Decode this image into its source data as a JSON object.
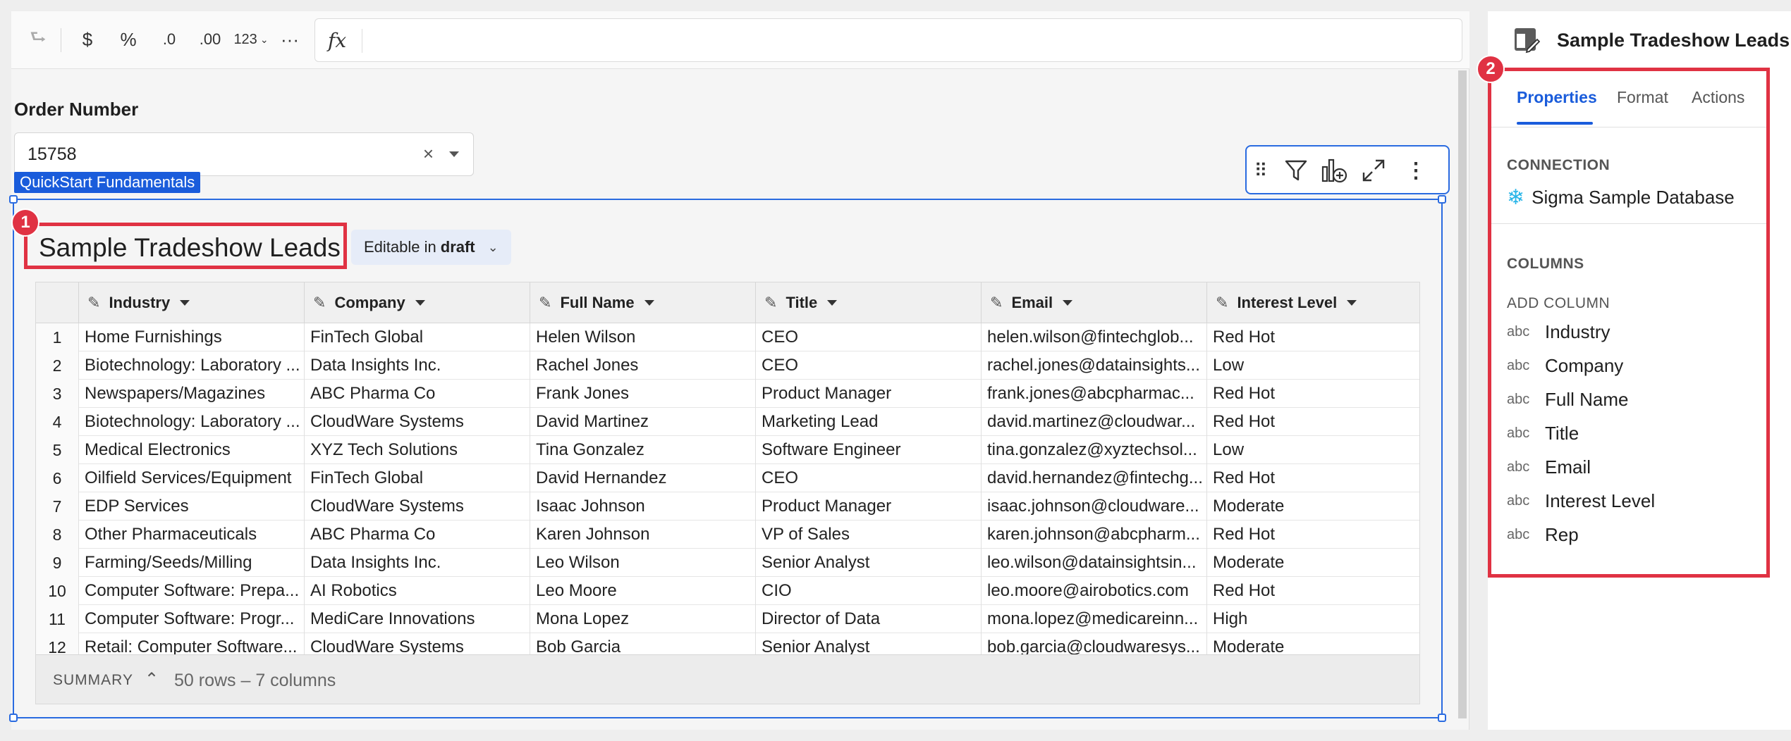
{
  "toolbar": {
    "redo_icon": "redo-icon",
    "currency_label": "$",
    "percent_label": "%",
    "decrease_decimals_label": ".0",
    "increase_decimals_label": ".00",
    "number_format_label": "123",
    "more_label": "···",
    "fx_label": "fx"
  },
  "control": {
    "label": "Order Number",
    "value": "15758",
    "clear_label": "×"
  },
  "tag": "QuickStart Fundamentals",
  "element": {
    "title": "Sample Tradeshow Leads",
    "badge": "1",
    "edit_prefix": "Editable in",
    "edit_state": "draft"
  },
  "table": {
    "columns": [
      "Industry",
      "Company",
      "Full Name",
      "Title",
      "Email",
      "Interest Level"
    ],
    "rows": [
      [
        "1",
        "Home Furnishings",
        "FinTech Global",
        "Helen Wilson",
        "CEO",
        "helen.wilson@fintechglob...",
        "Red Hot"
      ],
      [
        "2",
        "Biotechnology: Laboratory ...",
        "Data Insights Inc.",
        "Rachel Jones",
        "CEO",
        "rachel.jones@datainsights...",
        "Low"
      ],
      [
        "3",
        "Newspapers/Magazines",
        "ABC Pharma Co",
        "Frank Jones",
        "Product Manager",
        "frank.jones@abcpharmac...",
        "Red Hot"
      ],
      [
        "4",
        "Biotechnology: Laboratory ...",
        "CloudWare Systems",
        "David Martinez",
        "Marketing Lead",
        "david.martinez@cloudwar...",
        "Red Hot"
      ],
      [
        "5",
        "Medical Electronics",
        "XYZ Tech Solutions",
        "Tina Gonzalez",
        "Software Engineer",
        "tina.gonzalez@xyztechsol...",
        "Low"
      ],
      [
        "6",
        "Oilfield Services/Equipment",
        "FinTech Global",
        "David Hernandez",
        "CEO",
        "david.hernandez@fintechg...",
        "Red Hot"
      ],
      [
        "7",
        "EDP Services",
        "CloudWare Systems",
        "Isaac Johnson",
        "Product Manager",
        "isaac.johnson@cloudware...",
        "Moderate"
      ],
      [
        "8",
        "Other Pharmaceuticals",
        "ABC Pharma Co",
        "Karen Johnson",
        "VP of Sales",
        "karen.johnson@abcpharm...",
        "Red Hot"
      ],
      [
        "9",
        "Farming/Seeds/Milling",
        "Data Insights Inc.",
        "Leo Wilson",
        "Senior Analyst",
        "leo.wilson@datainsightsin...",
        "Moderate"
      ],
      [
        "10",
        "Computer Software: Prepa...",
        "AI Robotics",
        "Leo Moore",
        "CIO",
        "leo.moore@airobotics.com",
        "Red Hot"
      ],
      [
        "11",
        "Computer Software: Progr...",
        "MediCare Innovations",
        "Mona Lopez",
        "Director of Data",
        "mona.lopez@medicareinn...",
        "High"
      ],
      [
        "12",
        "Retail: Computer Software...",
        "CloudWare Systems",
        "Bob Garcia",
        "Senior Analyst",
        "bob.garcia@cloudwaresys...",
        "Moderate"
      ]
    ],
    "summary_label": "SUMMARY",
    "summary_count": "50 rows – 7 columns"
  },
  "panel": {
    "title": "Sample Tradeshow Leads",
    "badge": "2",
    "tabs": [
      "Properties",
      "Format",
      "Actions"
    ],
    "connection_label": "CONNECTION",
    "connection_name": "Sigma Sample Database",
    "columns_label": "COLUMNS",
    "add_column_label": "ADD COLUMN",
    "columns": [
      {
        "type": "abc",
        "name": "Industry"
      },
      {
        "type": "abc",
        "name": "Company"
      },
      {
        "type": "abc",
        "name": "Full Name"
      },
      {
        "type": "abc",
        "name": "Title"
      },
      {
        "type": "abc",
        "name": "Email"
      },
      {
        "type": "abc",
        "name": "Interest Level"
      },
      {
        "type": "abc",
        "name": "Rep"
      }
    ]
  },
  "colors": {
    "accent": "#1a5cdb",
    "highlight": "#e03243",
    "snowflake": "#29b5e8"
  }
}
